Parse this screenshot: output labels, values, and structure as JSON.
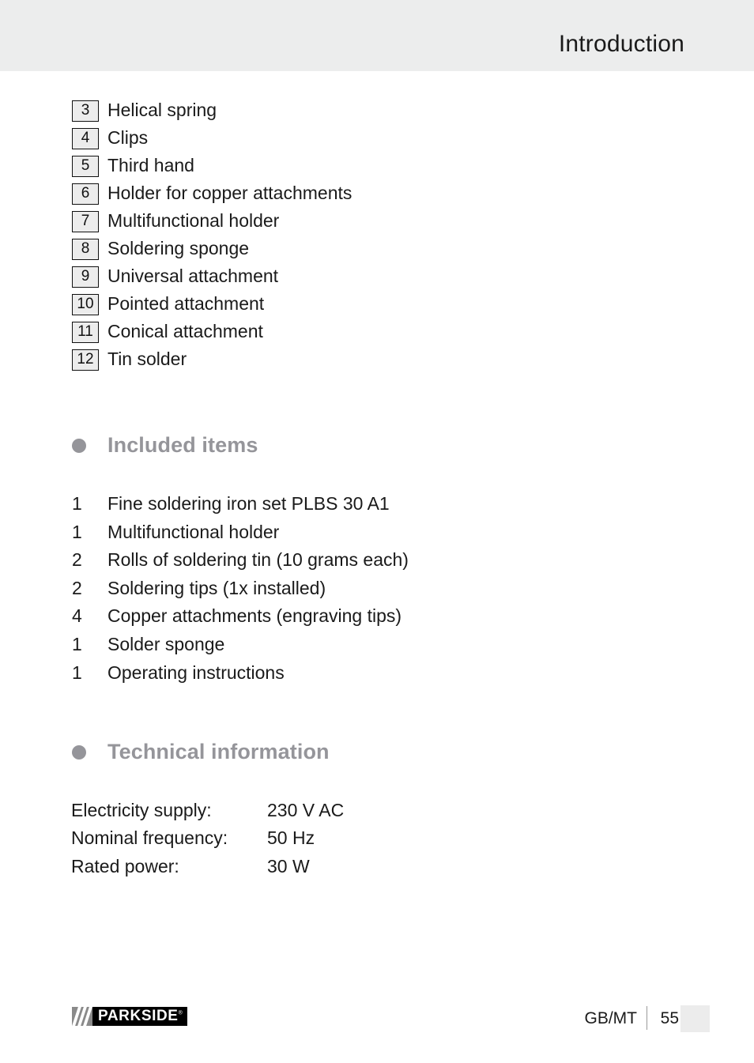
{
  "header": {
    "title": "Introduction"
  },
  "parts_list": [
    {
      "num": "3",
      "label": "Helical spring"
    },
    {
      "num": "4",
      "label": "Clips"
    },
    {
      "num": "5",
      "label": "Third hand"
    },
    {
      "num": "6",
      "label": "Holder for copper attachments"
    },
    {
      "num": "7",
      "label": "Multifunctional holder"
    },
    {
      "num": "8",
      "label": "Soldering sponge"
    },
    {
      "num": "9",
      "label": "Universal attachment"
    },
    {
      "num": "10",
      "label": "Pointed attachment"
    },
    {
      "num": "11",
      "label": "Conical attachment"
    },
    {
      "num": "12",
      "label": "Tin solder"
    }
  ],
  "included_items": {
    "heading": "Included items",
    "rows": [
      {
        "qty": "1",
        "label": "Fine soldering iron set PLBS 30 A1"
      },
      {
        "qty": "1",
        "label": "Multifunctional holder"
      },
      {
        "qty": "2",
        "label": "Rolls of soldering tin (10 grams each)"
      },
      {
        "qty": "2",
        "label": "Soldering tips (1x installed)"
      },
      {
        "qty": "4",
        "label": "Copper attachments (engraving tips)"
      },
      {
        "qty": "1",
        "label": "Solder sponge"
      },
      {
        "qty": "1",
        "label": "Operating instructions"
      }
    ]
  },
  "technical_information": {
    "heading": "Technical information",
    "rows": [
      {
        "label": "Electricity supply:",
        "value": "230 V AC"
      },
      {
        "label": "Nominal frequency:",
        "value": "50 Hz"
      },
      {
        "label": "Rated power:",
        "value": "30 W"
      }
    ]
  },
  "footer": {
    "brand": "PARKSIDE",
    "brand_registered": "®",
    "locale": "GB/MT",
    "page_number": "55"
  },
  "colors": {
    "header_band": "#eceded",
    "heading_gray": "#95959a",
    "num_box_fill": "#ececec",
    "text": "#1a1a1a",
    "brand_black": "#000000",
    "brand_gray": "#8a8a8a"
  }
}
